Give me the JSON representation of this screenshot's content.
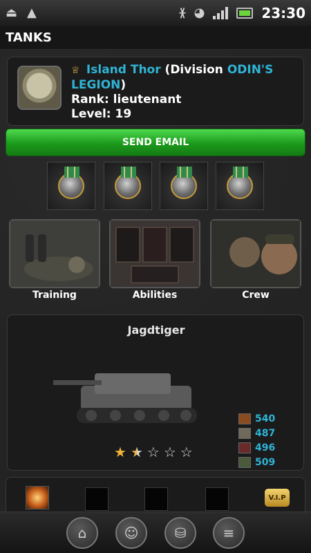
{
  "status_bar": {
    "time": "23:30",
    "icons": [
      "usb-icon",
      "android-icon",
      "bluetooth-icon",
      "wifi-icon",
      "signal-icon",
      "battery-icon"
    ]
  },
  "header": {
    "title": "TANKS"
  },
  "profile": {
    "player_name": "Island Thor",
    "division_prefix": "(Division ",
    "division_name": "ODIN'S LEGION",
    "division_suffix": ")",
    "rank": "Rank: lieutenant",
    "level": "Level: 19"
  },
  "actions": {
    "send_email": "SEND EMAIL"
  },
  "medals": [
    "medal-1",
    "medal-2",
    "medal-3",
    "medal-4"
  ],
  "sections": [
    {
      "label": "Training"
    },
    {
      "label": "Abilities"
    },
    {
      "label": "Crew"
    }
  ],
  "tank": {
    "name": "Jagdtiger",
    "stats": [
      {
        "icon": "explosion-icon",
        "value": "540"
      },
      {
        "icon": "armor-icon",
        "value": "487"
      },
      {
        "icon": "target-icon",
        "value": "496"
      },
      {
        "icon": "tread-icon",
        "value": "509"
      }
    ],
    "rating": {
      "filled": 1.5,
      "max": 5
    }
  },
  "slots": {
    "vip_label": "V.I.P"
  },
  "colors": {
    "accent": "#2fb4d6",
    "button_green": "#1b9a1b",
    "star": "#f0b43a"
  }
}
